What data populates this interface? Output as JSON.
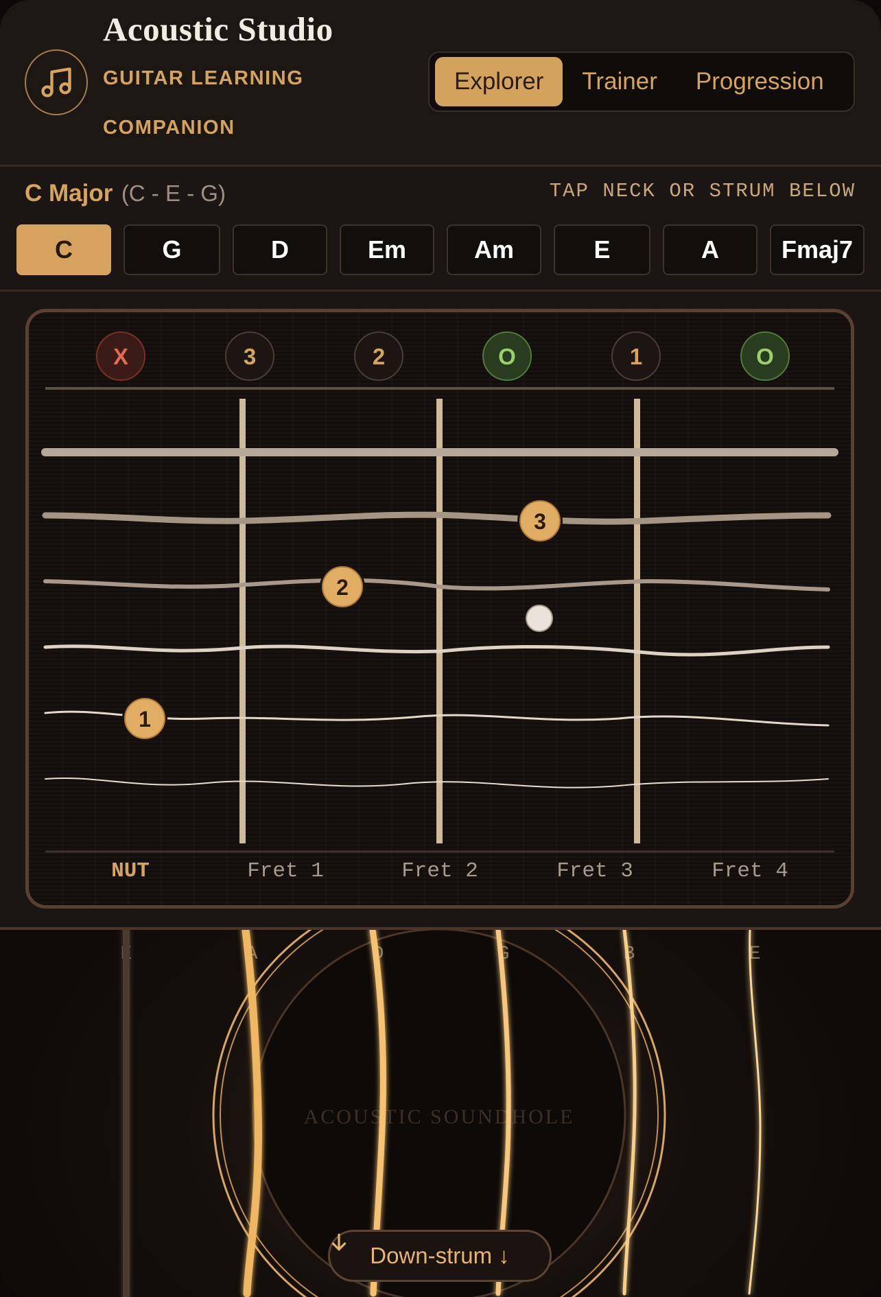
{
  "app": {
    "title": "Acoustic Studio",
    "subtitle": "GUITAR LEARNING COMPANION",
    "logo_icon": "music-note-icon"
  },
  "mode_tabs": [
    {
      "label": "Explorer",
      "active": true
    },
    {
      "label": "Trainer",
      "active": false
    },
    {
      "label": "Progression",
      "active": false
    }
  ],
  "current_chord": {
    "name": "C Major",
    "notes": "(C - E - G)"
  },
  "hint": "TAP NECK OR STRUM BELOW",
  "chords": [
    {
      "label": "C",
      "active": true
    },
    {
      "label": "G",
      "active": false
    },
    {
      "label": "D",
      "active": false
    },
    {
      "label": "Em",
      "active": false
    },
    {
      "label": "Am",
      "active": false
    },
    {
      "label": "E",
      "active": false
    },
    {
      "label": "A",
      "active": false
    },
    {
      "label": "Fmaj7",
      "active": false
    }
  ],
  "fretboard": {
    "string_status": [
      {
        "label": "X",
        "kind": "muted"
      },
      {
        "label": "3",
        "kind": "fret"
      },
      {
        "label": "2",
        "kind": "fret"
      },
      {
        "label": "O",
        "kind": "open"
      },
      {
        "label": "1",
        "kind": "fret"
      },
      {
        "label": "O",
        "kind": "open"
      }
    ],
    "fingers": [
      {
        "label": "3",
        "string": 2,
        "fret": 3
      },
      {
        "label": "2",
        "string": 3,
        "fret": 2
      },
      {
        "label": "1",
        "string": 5,
        "fret": 1
      }
    ],
    "fret_labels": [
      "NUT",
      "Fret 1",
      "Fret 2",
      "Fret 3",
      "Fret 4"
    ]
  },
  "soundhole": {
    "label": "ACOUSTIC SOUNDHOLE",
    "string_names": [
      "E",
      "A",
      "D",
      "G",
      "B",
      "E"
    ]
  },
  "strum_button": {
    "label": "Down-strum ↓",
    "icon": "arrow-down-icon"
  },
  "colors": {
    "accent": "#d5a35f",
    "background": "#1b1613",
    "muted": "#d9624c",
    "open": "#8fc76a"
  }
}
